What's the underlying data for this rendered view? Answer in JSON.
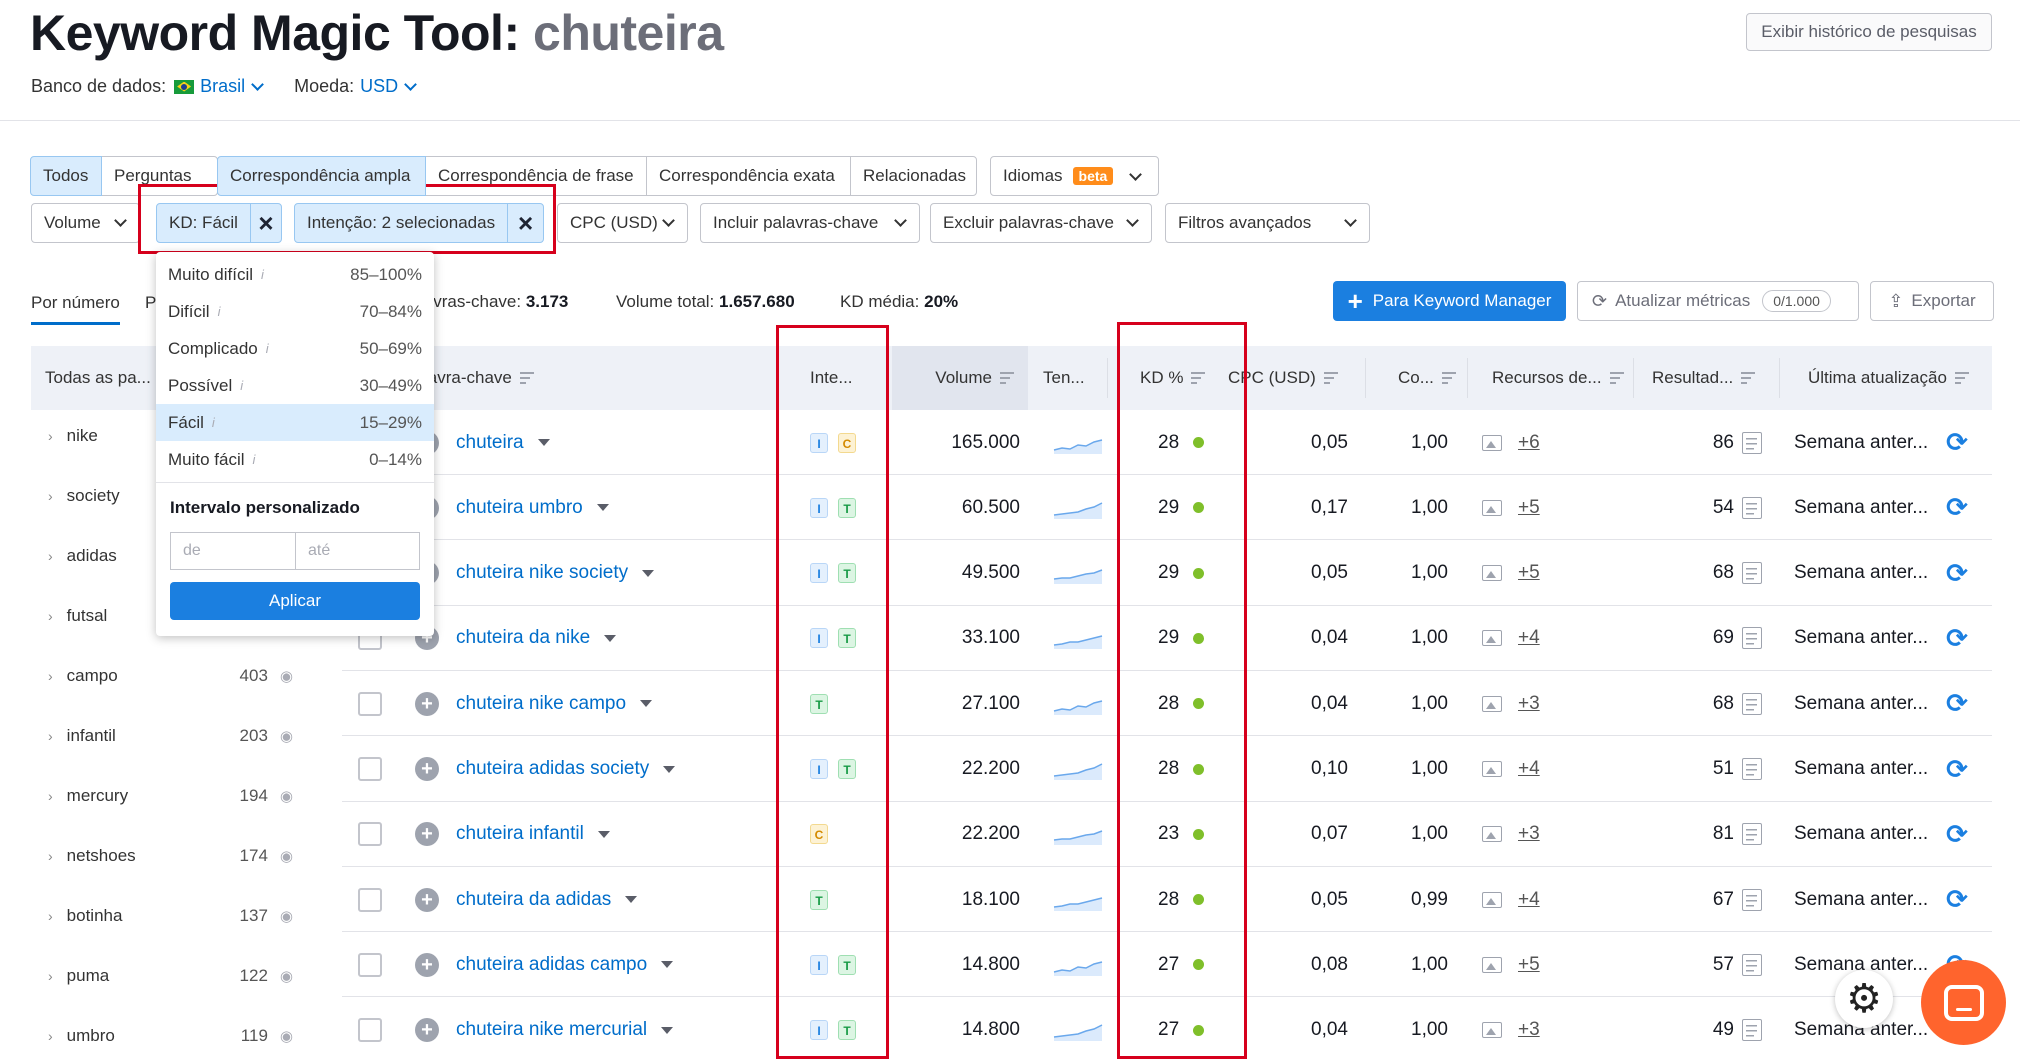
{
  "header": {
    "title": "Keyword Magic Tool:",
    "query": "chuteira",
    "database_label": "Banco de dados:",
    "database_value": "Brasil",
    "currency_label": "Moeda:",
    "currency_value": "USD",
    "history_button": "Exibir histórico de pesquisas"
  },
  "match_tabs": [
    "Todos",
    "Perguntas",
    "Correspondência ampla",
    "Correspondência de frase",
    "Correspondência exata",
    "Relacionadas"
  ],
  "languages": {
    "label": "Idiomas",
    "badge": "beta"
  },
  "filters": {
    "volume": "Volume",
    "kd_chip": "KD: Fácil",
    "intent_chip": "Intenção: 2 selecionadas",
    "cpc": "CPC (USD)",
    "include": "Incluir palavras-chave",
    "exclude": "Excluir palavras-chave",
    "advanced": "Filtros avançados"
  },
  "kd_dropdown": {
    "options": [
      {
        "label": "Muito difícil",
        "range": "85–100%"
      },
      {
        "label": "Difícil",
        "range": "70–84%"
      },
      {
        "label": "Complicado",
        "range": "50–69%"
      },
      {
        "label": "Possível",
        "range": "30–49%"
      },
      {
        "label": "Fácil",
        "range": "15–29%",
        "selected": true
      },
      {
        "label": "Muito fácil",
        "range": "0–14%"
      }
    ],
    "custom_label": "Intervalo personalizado",
    "from_placeholder": "de",
    "to_placeholder": "até",
    "apply": "Aplicar"
  },
  "subtabs": {
    "by_number": "Por número",
    "second": "P"
  },
  "stats": {
    "keywords_label": "lavras-chave:",
    "keywords_value": "3.173",
    "volume_label": "Volume total:",
    "volume_value": "1.657.680",
    "kd_label": "KD média:",
    "kd_value": "20%"
  },
  "actions": {
    "km_button": "Para Keyword Manager",
    "update_button": "Atualizar métricas",
    "update_count": "0/1.000",
    "export_button": "Exportar"
  },
  "sidebar": {
    "header": "Todas as pa...",
    "items": [
      {
        "label": "nike",
        "count": ""
      },
      {
        "label": "society",
        "count": ""
      },
      {
        "label": "adidas",
        "count": ""
      },
      {
        "label": "futsal",
        "count": ""
      },
      {
        "label": "campo",
        "count": "403"
      },
      {
        "label": "infantil",
        "count": "203"
      },
      {
        "label": "mercury",
        "count": "194"
      },
      {
        "label": "netshoes",
        "count": "174"
      },
      {
        "label": "botinha",
        "count": "137"
      },
      {
        "label": "puma",
        "count": "122"
      },
      {
        "label": "umbro",
        "count": "119"
      }
    ]
  },
  "table": {
    "headers": {
      "keyword": "lavra-chave",
      "intent": "Inte...",
      "volume": "Volume",
      "trend": "Ten...",
      "kd": "KD %",
      "cpc": "CPC (USD)",
      "com": "Co...",
      "features": "Recursos de...",
      "results": "Resultad...",
      "updated": "Última atualização"
    },
    "rows": [
      {
        "keyword": "chuteira",
        "intents": [
          "I",
          "C"
        ],
        "volume": "165.000",
        "kd": "28",
        "cpc": "0,05",
        "com": "1,00",
        "features": "+6",
        "results": "86",
        "updated": "Semana anter..."
      },
      {
        "keyword": "chuteira umbro",
        "intents": [
          "I",
          "T"
        ],
        "volume": "60.500",
        "kd": "29",
        "cpc": "0,17",
        "com": "1,00",
        "features": "+5",
        "results": "54",
        "updated": "Semana anter..."
      },
      {
        "keyword": "chuteira nike society",
        "intents": [
          "I",
          "T"
        ],
        "volume": "49.500",
        "kd": "29",
        "cpc": "0,05",
        "com": "1,00",
        "features": "+5",
        "results": "68",
        "updated": "Semana anter..."
      },
      {
        "keyword": "chuteira da nike",
        "intents": [
          "I",
          "T"
        ],
        "volume": "33.100",
        "kd": "29",
        "cpc": "0,04",
        "com": "1,00",
        "features": "+4",
        "results": "69",
        "updated": "Semana anter..."
      },
      {
        "keyword": "chuteira nike campo",
        "intents": [
          "T"
        ],
        "volume": "27.100",
        "kd": "28",
        "cpc": "0,04",
        "com": "1,00",
        "features": "+3",
        "results": "68",
        "updated": "Semana anter..."
      },
      {
        "keyword": "chuteira adidas society",
        "intents": [
          "I",
          "T"
        ],
        "volume": "22.200",
        "kd": "28",
        "cpc": "0,10",
        "com": "1,00",
        "features": "+4",
        "results": "51",
        "updated": "Semana anter..."
      },
      {
        "keyword": "chuteira infantil",
        "intents": [
          "C"
        ],
        "volume": "22.200",
        "kd": "23",
        "cpc": "0,07",
        "com": "1,00",
        "features": "+3",
        "results": "81",
        "updated": "Semana anter..."
      },
      {
        "keyword": "chuteira da adidas",
        "intents": [
          "T"
        ],
        "volume": "18.100",
        "kd": "28",
        "cpc": "0,05",
        "com": "0,99",
        "features": "+4",
        "results": "67",
        "updated": "Semana anter..."
      },
      {
        "keyword": "chuteira adidas campo",
        "intents": [
          "I",
          "T"
        ],
        "volume": "14.800",
        "kd": "27",
        "cpc": "0,08",
        "com": "1,00",
        "features": "+5",
        "results": "57",
        "updated": "Semana anter..."
      },
      {
        "keyword": "chuteira nike mercurial",
        "intents": [
          "I",
          "T"
        ],
        "volume": "14.800",
        "kd": "27",
        "cpc": "0,04",
        "com": "1,00",
        "features": "+3",
        "results": "49",
        "updated": "Semana anter..."
      }
    ]
  },
  "colors": {
    "accent": "#006dca",
    "primary_button": "#1b7fe0",
    "highlight_box": "#d6001c",
    "kd_dot": "#7fbf2a",
    "chat_fab": "#ff642d"
  }
}
